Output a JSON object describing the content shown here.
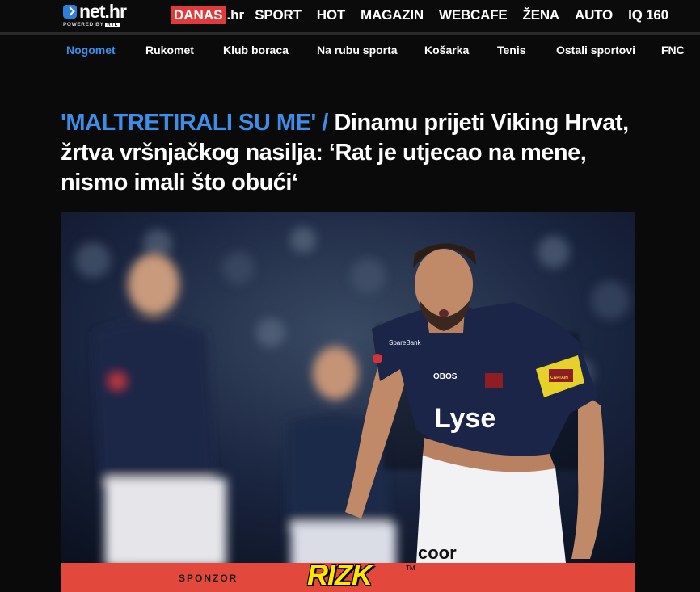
{
  "logo": {
    "name": "net.hr",
    "sub": "POWERED BY",
    "sub_brand": "RTL"
  },
  "mainnav": {
    "danas_box": "DANAS",
    "danas_ext": ".hr",
    "items": [
      "SPORT",
      "HOT",
      "MAGAZIN",
      "WEBCAFE",
      "ŽENA",
      "AUTO",
      "IQ 160"
    ]
  },
  "subnav": {
    "items": [
      "Nogomet",
      "Rukomet",
      "Klub boraca",
      "Na rubu sporta",
      "Košarka",
      "Tenis",
      "Ostali sportovi",
      "FNC"
    ],
    "active_index": 0
  },
  "article": {
    "kicker": "'MALTRETIRALI SU ME' /",
    "title": "Dinamu prijeti Viking Hrvat, žrtva vršnjačkog nasilja: ‘Rat je utjecao na mene, nismo imali što obući‘"
  },
  "photo": {
    "jersey_sponsor": "Lyse",
    "chest_badge": "OBOS",
    "shorts_sponsor": "coor",
    "sleeve_text": "SpareBank",
    "captain_band": "CAPTAIN"
  },
  "sponsor_bar": {
    "label": "SPONZOR",
    "brand": "RIZK",
    "tm": "TM"
  },
  "colors": {
    "accent": "#3d8ee6",
    "danas_red": "#e03a3a",
    "sponsor_bg": "#e2483b",
    "rizk_yellow": "#ffe600"
  }
}
